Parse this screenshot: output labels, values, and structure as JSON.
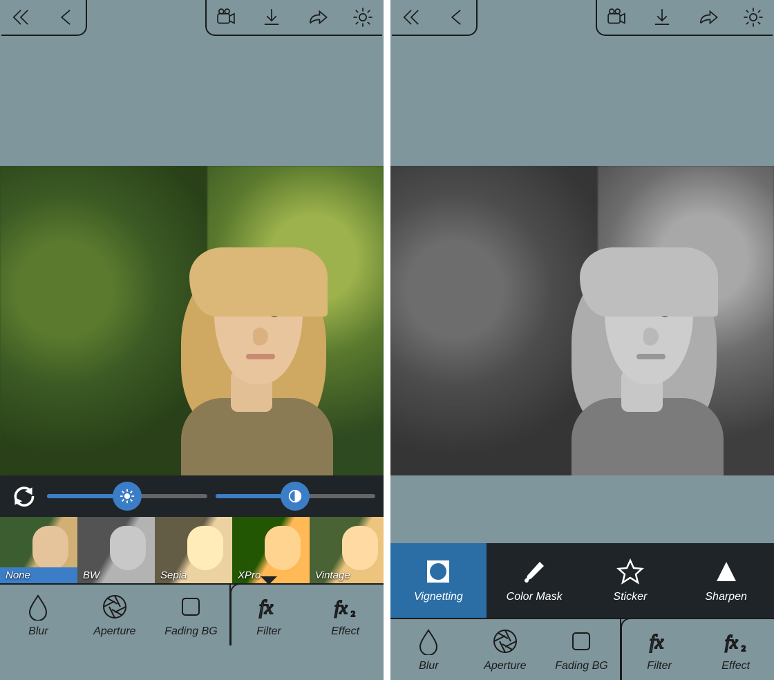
{
  "toolbar_icons": {
    "double_back": "double-chevron-back",
    "back": "chevron-back",
    "video": "video",
    "download": "download",
    "share": "share",
    "settings": "settings"
  },
  "left": {
    "sliders": {
      "brightness_pct": 50,
      "contrast_pct": 50
    },
    "filters": [
      {
        "id": "none",
        "label": "None",
        "selected": true
      },
      {
        "id": "bw",
        "label": "BW",
        "selected": false
      },
      {
        "id": "sepia",
        "label": "Sepia",
        "selected": false
      },
      {
        "id": "xpro",
        "label": "XPro",
        "selected": false
      },
      {
        "id": "vintage",
        "label": "Vintage",
        "selected": false
      }
    ],
    "bottom_active": "filter"
  },
  "right": {
    "effects": [
      {
        "id": "vignetting",
        "label": "Vignetting",
        "selected": true
      },
      {
        "id": "colormask",
        "label": "Color Mask",
        "selected": false
      },
      {
        "id": "sticker",
        "label": "Sticker",
        "selected": false
      },
      {
        "id": "sharpen",
        "label": "Sharpen",
        "selected": false
      }
    ],
    "bottom_active": "effect"
  },
  "bottom_tabs": [
    {
      "id": "blur",
      "label": "Blur"
    },
    {
      "id": "aperture",
      "label": "Aperture"
    },
    {
      "id": "fadingbg",
      "label": "Fading BG"
    },
    {
      "id": "filter",
      "label": "Filter"
    },
    {
      "id": "effect",
      "label": "Effect"
    }
  ]
}
